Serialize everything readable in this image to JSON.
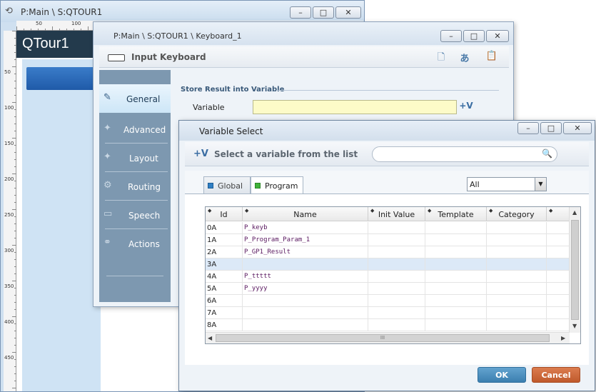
{
  "win1": {
    "title": "P:Main \\ S:QTOUR1",
    "header": "QTour1",
    "ruler_h": [
      "50",
      "100",
      "150",
      "200",
      "250",
      "300",
      "350",
      "400",
      "450"
    ],
    "ruler_v": [
      "50",
      "100",
      "150",
      "200",
      "250",
      "300",
      "350",
      "400",
      "450"
    ],
    "controls": {
      "minimize": "–",
      "maximize": "□",
      "close": "✕"
    }
  },
  "win2": {
    "title": "P:Main \\ S:QTOUR1 \\ Keyboard_1",
    "subtitle": "Input Keyboard",
    "sidebar": [
      {
        "label": "General",
        "icon": "pencil-icon",
        "active": true
      },
      {
        "label": "Advanced",
        "icon": "wrench-icon",
        "active": false
      },
      {
        "label": "Layout",
        "icon": "layout-icon",
        "active": false
      },
      {
        "label": "Routing",
        "icon": "gear-icon",
        "active": false
      },
      {
        "label": "Speech",
        "icon": "speech-icon",
        "active": false
      },
      {
        "label": "Actions",
        "icon": "actions-icon",
        "active": false
      }
    ],
    "group_label": "Store Result into Variable",
    "variable_label": "Variable",
    "variable_value": "",
    "variable_button": "+V"
  },
  "win3": {
    "title": "Variable Select",
    "header_text": "Select a variable from the list",
    "header_icon": "+V",
    "search_placeholder": "",
    "tabs": [
      {
        "label": "Global",
        "color": "#2f7fc4"
      },
      {
        "label": "Program",
        "color": "#41b23a"
      }
    ],
    "filter_value": "All",
    "columns": [
      "Id",
      "Name",
      "Init Value",
      "Template",
      "Category",
      ""
    ],
    "rows": [
      {
        "id": "0A",
        "name": "P_keyb"
      },
      {
        "id": "1A",
        "name": "P_Program_Param_1"
      },
      {
        "id": "2A",
        "name": "P_GP1_Result"
      },
      {
        "id": "3A",
        "name": ""
      },
      {
        "id": "4A",
        "name": "P_ttttt"
      },
      {
        "id": "5A",
        "name": "P_yyyy"
      },
      {
        "id": "6A",
        "name": ""
      },
      {
        "id": "7A",
        "name": ""
      },
      {
        "id": "8A",
        "name": ""
      }
    ],
    "selected_row": 3,
    "ok_label": "OK",
    "cancel_label": "Cancel",
    "scroll_grip": "III"
  }
}
